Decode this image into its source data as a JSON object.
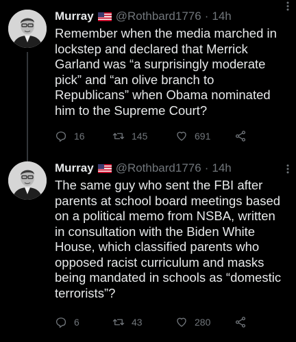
{
  "tweets": [
    {
      "name": "Murray",
      "handle": "@Rothbard1776",
      "separator": "·",
      "time": "14h",
      "text": "Remember when the media marched in\nlockstep and declared that Merrick\nGarland was “a surprisingly moderate\npick” and “an olive branch to\nRepublicans” when Obama nominated\nhim to the Supreme Court?",
      "replies": "16",
      "retweets": "145",
      "likes": "691"
    },
    {
      "name": "Murray",
      "handle": "@Rothbard1776",
      "separator": "·",
      "time": "14h",
      "text": "The same guy who sent the FBI after\nparents at school board meetings based\non a political memo from NSBA, written\nin consultation with the Biden White\nHouse, which classified parents who\nopposed racist curriculum and masks\nbeing mandated in schools as “domestic\nterrorists”?",
      "replies": "6",
      "retweets": "43",
      "likes": "280"
    }
  ],
  "icons": {
    "more": "more-dots-icon",
    "reply": "reply-icon",
    "retweet": "retweet-icon",
    "like": "heart-icon",
    "share": "share-icon",
    "flag": "us-flag-icon"
  },
  "colors": {
    "background": "#000000",
    "text_primary": "#e7e9ea",
    "text_secondary": "#71767b",
    "thread_line": "#333639"
  }
}
